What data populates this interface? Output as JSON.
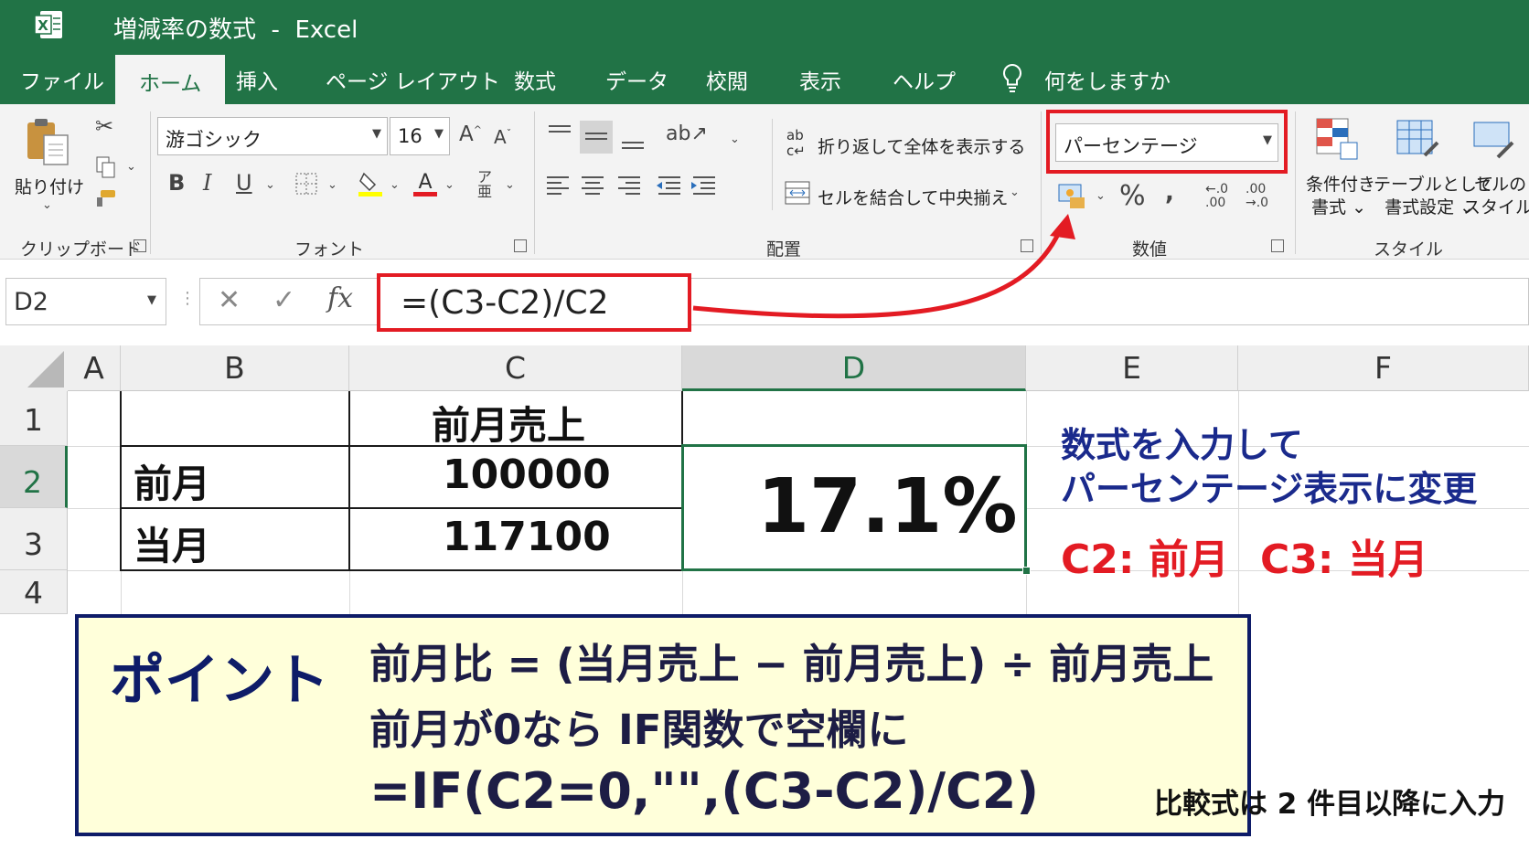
{
  "window": {
    "title": "増減率の数式  -  Excel",
    "app_icon": "excel-logo-icon"
  },
  "tabs": [
    "ファイル",
    "ホーム",
    "挿入",
    "ページ レイアウト",
    "数式",
    "データ",
    "校閲",
    "表示",
    "ヘルプ"
  ],
  "active_tab": "ホーム",
  "tell_me": "何をしますか",
  "ribbon": {
    "clipboard": {
      "paste": "貼り付け",
      "label": "クリップボード"
    },
    "font": {
      "name": "游ゴシック",
      "size": "16",
      "bold": "B",
      "italic": "I",
      "underline": "U",
      "label": "フォント"
    },
    "alignment": {
      "wrap_text": "折り返して全体を表示する",
      "merge_center": "セルを結合して中央揃え",
      "label": "配置"
    },
    "number": {
      "format": "パーセンテージ",
      "percent": "%",
      "comma": ",",
      "label": "数値"
    },
    "styles": {
      "conditional": [
        "条件付き",
        "書式"
      ],
      "as_table": [
        "テーブルとして",
        "書式設定"
      ],
      "cell_styles": [
        "セルの",
        "スタイル"
      ],
      "label": "スタイル"
    }
  },
  "formula_bar": {
    "name_box": "D2",
    "cancel": "✕",
    "enter": "✓",
    "fx": "fx",
    "formula": "=(C3-C2)/C2"
  },
  "sheet": {
    "columns": [
      "A",
      "B",
      "C",
      "D",
      "E",
      "F"
    ],
    "selected_column": "D",
    "rows": [
      "1",
      "2",
      "3",
      "4"
    ],
    "selected_row": "2",
    "cells": {
      "C1": "前月売上",
      "B2": "前月",
      "C2": "100000",
      "D2": "17.1%",
      "B3": "当月",
      "C3": "117100"
    }
  },
  "annotations": {
    "note_line1": "数式を入力して",
    "note_line2": "パーセンテージ表示に変更",
    "c2_label": "C2: 前月",
    "c3_label": "C3: 当月",
    "note_color": "#1a2a8c",
    "highlight_color": "#e31b23"
  },
  "point": {
    "title": "ポイント",
    "line1": "前月比 = (当月売上 − 前月売上) ÷ 前月売上",
    "line2": "前月が0なら IF関数で空欄に",
    "line3": "=IF(C2=0,\"\",(C3-C2)/C2)"
  },
  "footnote": "比較式は 2 件目以降に入力",
  "colors": {
    "excel_green": "#217346",
    "point_bg": "#ffffda",
    "point_border": "#0e1c68"
  }
}
